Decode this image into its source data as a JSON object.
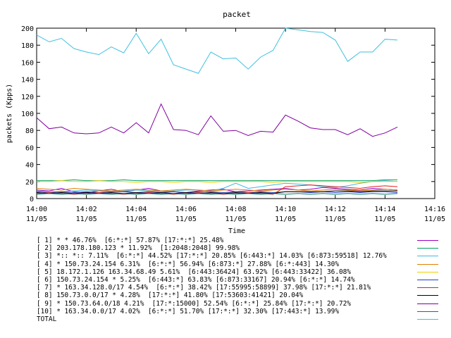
{
  "chart_data": {
    "type": "line",
    "title": "packet",
    "xlabel": "Time",
    "ylabel": "packets (Kpps)",
    "ylim": [
      0,
      200
    ],
    "yticks": [
      0,
      20,
      40,
      60,
      80,
      100,
      120,
      140,
      160,
      180,
      200
    ],
    "grid": false,
    "legend_placement": "bottom",
    "xticks": [
      {
        "time": "14:00",
        "date": "11/05"
      },
      {
        "time": "14:02",
        "date": "11/05"
      },
      {
        "time": "14:04",
        "date": "11/05"
      },
      {
        "time": "14:06",
        "date": "11/05"
      },
      {
        "time": "14:08",
        "date": "11/05"
      },
      {
        "time": "14:10",
        "date": "11/05"
      },
      {
        "time": "14:12",
        "date": "11/05"
      },
      {
        "time": "14:14",
        "date": "11/05"
      },
      {
        "time": "14:16",
        "date": "11/05"
      }
    ],
    "x_time": [
      "14:00",
      "14:00:30",
      "14:01",
      "14:01:30",
      "14:02",
      "14:02:30",
      "14:03",
      "14:03:30",
      "14:04",
      "14:04:30",
      "14:05",
      "14:05:30",
      "14:06",
      "14:06:30",
      "14:07",
      "14:07:30",
      "14:08",
      "14:08:30",
      "14:09",
      "14:09:30",
      "14:10",
      "14:10:30",
      "14:11",
      "14:11:30",
      "14:12",
      "14:12:30",
      "14:13",
      "14:13:30",
      "14:14",
      "14:14:30"
    ],
    "x_minutes": [
      0,
      0.5,
      1,
      1.5,
      2,
      2.5,
      3,
      3.5,
      4,
      4.5,
      5,
      5.5,
      6,
      6.5,
      7,
      7.5,
      8,
      8.5,
      9,
      9.5,
      10,
      10.5,
      11,
      11.5,
      12,
      12.5,
      13,
      13.5,
      14,
      14.5
    ],
    "x_range_minutes": [
      0,
      16
    ],
    "series": [
      {
        "label": "[ 1] * * 46.76%  [6:*:*] 57.87% [17:*:*] 25.48%",
        "color": "#a000c0",
        "values": [
          10,
          9,
          12,
          8,
          7,
          9,
          11,
          8,
          10,
          12,
          9,
          8,
          7,
          9,
          10,
          11,
          8,
          9,
          10,
          11,
          12,
          10,
          11,
          13,
          12,
          11,
          10,
          12,
          11,
          10
        ]
      },
      {
        "label": "[ 2] 203.178.180.123 * 11.92%  [1:2048:2048] 99.98%",
        "color": "#00a060",
        "values": [
          21,
          21,
          21,
          22,
          21,
          21,
          21,
          22,
          21,
          21,
          21,
          21,
          21,
          21,
          21,
          21,
          21,
          21,
          21,
          21,
          21,
          21,
          21,
          21,
          21,
          21,
          21,
          21,
          22,
          22
        ]
      },
      {
        "label": "[ 3] *:: *:: 7.11%  [6:*:*] 44.52% [17:*:*] 20.85% [6:443:*] 14.03% [6:873:59518] 12.76%",
        "color": "#40b8e0",
        "values": [
          9,
          8,
          8,
          9,
          10,
          9,
          8,
          9,
          10,
          9,
          8,
          9,
          10,
          10,
          9,
          12,
          18,
          12,
          14,
          16,
          18,
          17,
          16,
          14,
          13,
          15,
          18,
          20,
          21,
          20
        ]
      },
      {
        "label": "[ 4] * 150.73.24.154 6.31%  [6:*:*] 56.94% [6:873:*] 27.88% [6:*:443] 14.30%",
        "color": "#e08000",
        "values": [
          12,
          11,
          10,
          12,
          11,
          10,
          9,
          10,
          11,
          10,
          9,
          10,
          11,
          10,
          9,
          10,
          11,
          10,
          9,
          10,
          11,
          10,
          9,
          10,
          11,
          10,
          9,
          10,
          11,
          10
        ]
      },
      {
        "label": "[ 5] 18.172.1.126 163.34.68.49 5.61%  [6:443:36424] 63.92% [6:443:33422] 36.08%",
        "color": "#f0d000",
        "values": [
          20,
          20,
          21,
          20,
          20,
          21,
          20,
          20,
          19,
          20,
          20,
          19,
          20,
          20,
          19,
          20,
          20,
          20,
          20,
          19,
          20,
          20,
          20,
          20,
          20,
          20,
          19,
          20,
          20,
          20
        ]
      },
      {
        "label": "[ 6] 150.73.24.154 * 5.25%  [6:443:*] 63.83% [6:873:33167] 20.94% [6:*:*] 14.74%",
        "color": "#2040c0",
        "values": [
          8,
          7,
          8,
          7,
          8,
          7,
          8,
          8,
          7,
          8,
          7,
          8,
          7,
          8,
          8,
          7,
          8,
          7,
          8,
          7,
          8,
          8,
          7,
          8,
          7,
          8,
          7,
          8,
          8,
          7
        ]
      },
      {
        "label": "[ 7] * 163.34.128.0/17 4.54%  [6:*:*] 38.42% [17:55995:58899] 37.98% [17:*:*] 21.81%",
        "color": "#e02020",
        "values": [
          6,
          7,
          6,
          5,
          6,
          7,
          6,
          5,
          6,
          7,
          6,
          5,
          6,
          7,
          6,
          5,
          6,
          7,
          6,
          5,
          14,
          15,
          16,
          15,
          14,
          13,
          12,
          14,
          15,
          14
        ]
      },
      {
        "label": "[ 8] 150.73.0.0/17 * 4.28%  [17:*:*] 41.80% [17:53603:41421] 20.04%",
        "color": "#000000",
        "values": [
          7,
          6,
          7,
          6,
          7,
          6,
          7,
          6,
          7,
          6,
          7,
          6,
          7,
          6,
          7,
          6,
          7,
          6,
          7,
          6,
          8,
          8,
          8,
          8,
          9,
          9,
          8,
          9,
          9,
          9
        ]
      },
      {
        "label": "[ 9] * 150.73.64.0/18 4.21%  [17:*:15000] 52.54% [6:*:*] 25.84% [17:*:*] 20.72%",
        "color": "#8000a0",
        "values": [
          95,
          82,
          84,
          77,
          76,
          77,
          84,
          77,
          89,
          77,
          111,
          81,
          80,
          75,
          97,
          79,
          80,
          74,
          79,
          78,
          98,
          91,
          83,
          81,
          81,
          75,
          82,
          73,
          77,
          84
        ]
      },
      {
        "label": "[10] * 163.34.0.0/17 4.02%  [6:*:*] 51.70% [17:*:*] 32.30% [17:443:*] 13.99%",
        "color": "#008060",
        "values": [
          5,
          6,
          5,
          6,
          5,
          6,
          5,
          6,
          5,
          6,
          5,
          6,
          5,
          6,
          5,
          6,
          5,
          6,
          5,
          6,
          5,
          6,
          5,
          6,
          5,
          6,
          5,
          6,
          5,
          6
        ]
      },
      {
        "label": "TOTAL",
        "color": "#40c0e0",
        "values": [
          192,
          184,
          188,
          176,
          172,
          169,
          178,
          171,
          194,
          170,
          187,
          157,
          152,
          147,
          172,
          164,
          165,
          152,
          166,
          174,
          200,
          198,
          196,
          195,
          186,
          161,
          172,
          172,
          187,
          186
        ]
      }
    ]
  }
}
